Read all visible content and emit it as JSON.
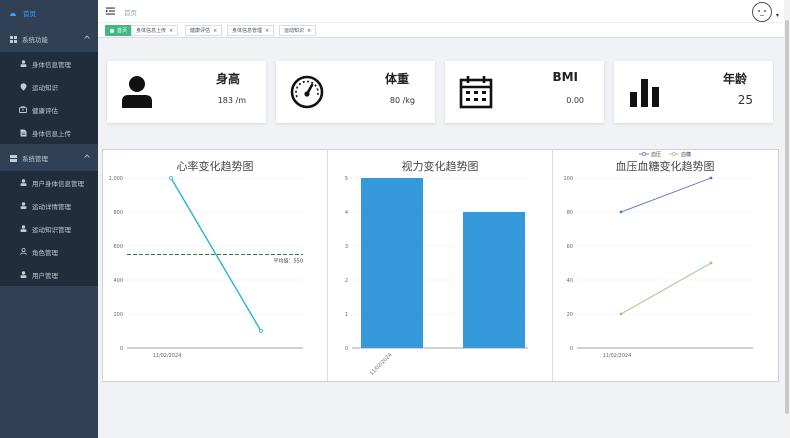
{
  "sidebar": {
    "home": "首页",
    "groups": [
      {
        "label": "系统功能",
        "items": [
          "身体信息管理",
          "运动知识",
          "健康评估",
          "身体信息上传"
        ]
      },
      {
        "label": "系统管理",
        "items": [
          "用户身体信息管理",
          "运动详情管理",
          "运动知识管理",
          "角色管理",
          "用户管理"
        ]
      }
    ]
  },
  "header": {
    "breadcrumb": "首页"
  },
  "tags": [
    {
      "label": "首页",
      "active": true
    },
    {
      "label": "身体信息上传",
      "active": false
    },
    {
      "label": "健康评估",
      "active": false
    },
    {
      "label": "身体信息管理",
      "active": false
    },
    {
      "label": "运动知识",
      "active": false
    }
  ],
  "stats": [
    {
      "label": "身高",
      "value": "183 /m",
      "icon": "user-icon"
    },
    {
      "label": "体重",
      "value": "80 /kg",
      "icon": "gauge-icon"
    },
    {
      "label": "BMI",
      "value": "0.00",
      "icon": "calendar-icon"
    },
    {
      "label": "年龄",
      "value": "25",
      "icon": "bar-chart-icon"
    }
  ],
  "chart_data": [
    {
      "type": "line",
      "title": "心率变化趋势图",
      "categories": [
        "11/02/2024"
      ],
      "series": [
        {
          "values": [
            1000,
            100
          ]
        }
      ],
      "ylim": [
        0,
        1000
      ],
      "yticks": [
        "0",
        "200",
        "400",
        "600",
        "800",
        "1,000"
      ],
      "mark_line": {
        "label": "平均值：550",
        "value": 550
      },
      "colors": {
        "line": "#26b5d4",
        "mark": "#2e7d32"
      }
    },
    {
      "type": "bar",
      "title": "视力变化趋势图",
      "categories": [
        "11/02/2024"
      ],
      "values": [
        5,
        4
      ],
      "ylim": [
        0,
        5
      ],
      "yticks": [
        "0",
        "1",
        "2",
        "3",
        "4",
        "5"
      ],
      "colors": {
        "bar": "#3498db"
      }
    },
    {
      "type": "line",
      "title": "血压血糖变化趋势图",
      "categories": [
        "11/02/2024"
      ],
      "series": [
        {
          "name": "血压",
          "values": [
            80,
            100
          ],
          "color": "#5470c6"
        },
        {
          "name": "血糖",
          "values": [
            20,
            50
          ],
          "color": "#91cc75"
        }
      ],
      "ylim": [
        0,
        100
      ],
      "yticks": [
        "0",
        "20",
        "40",
        "60",
        "80",
        "100"
      ]
    }
  ]
}
